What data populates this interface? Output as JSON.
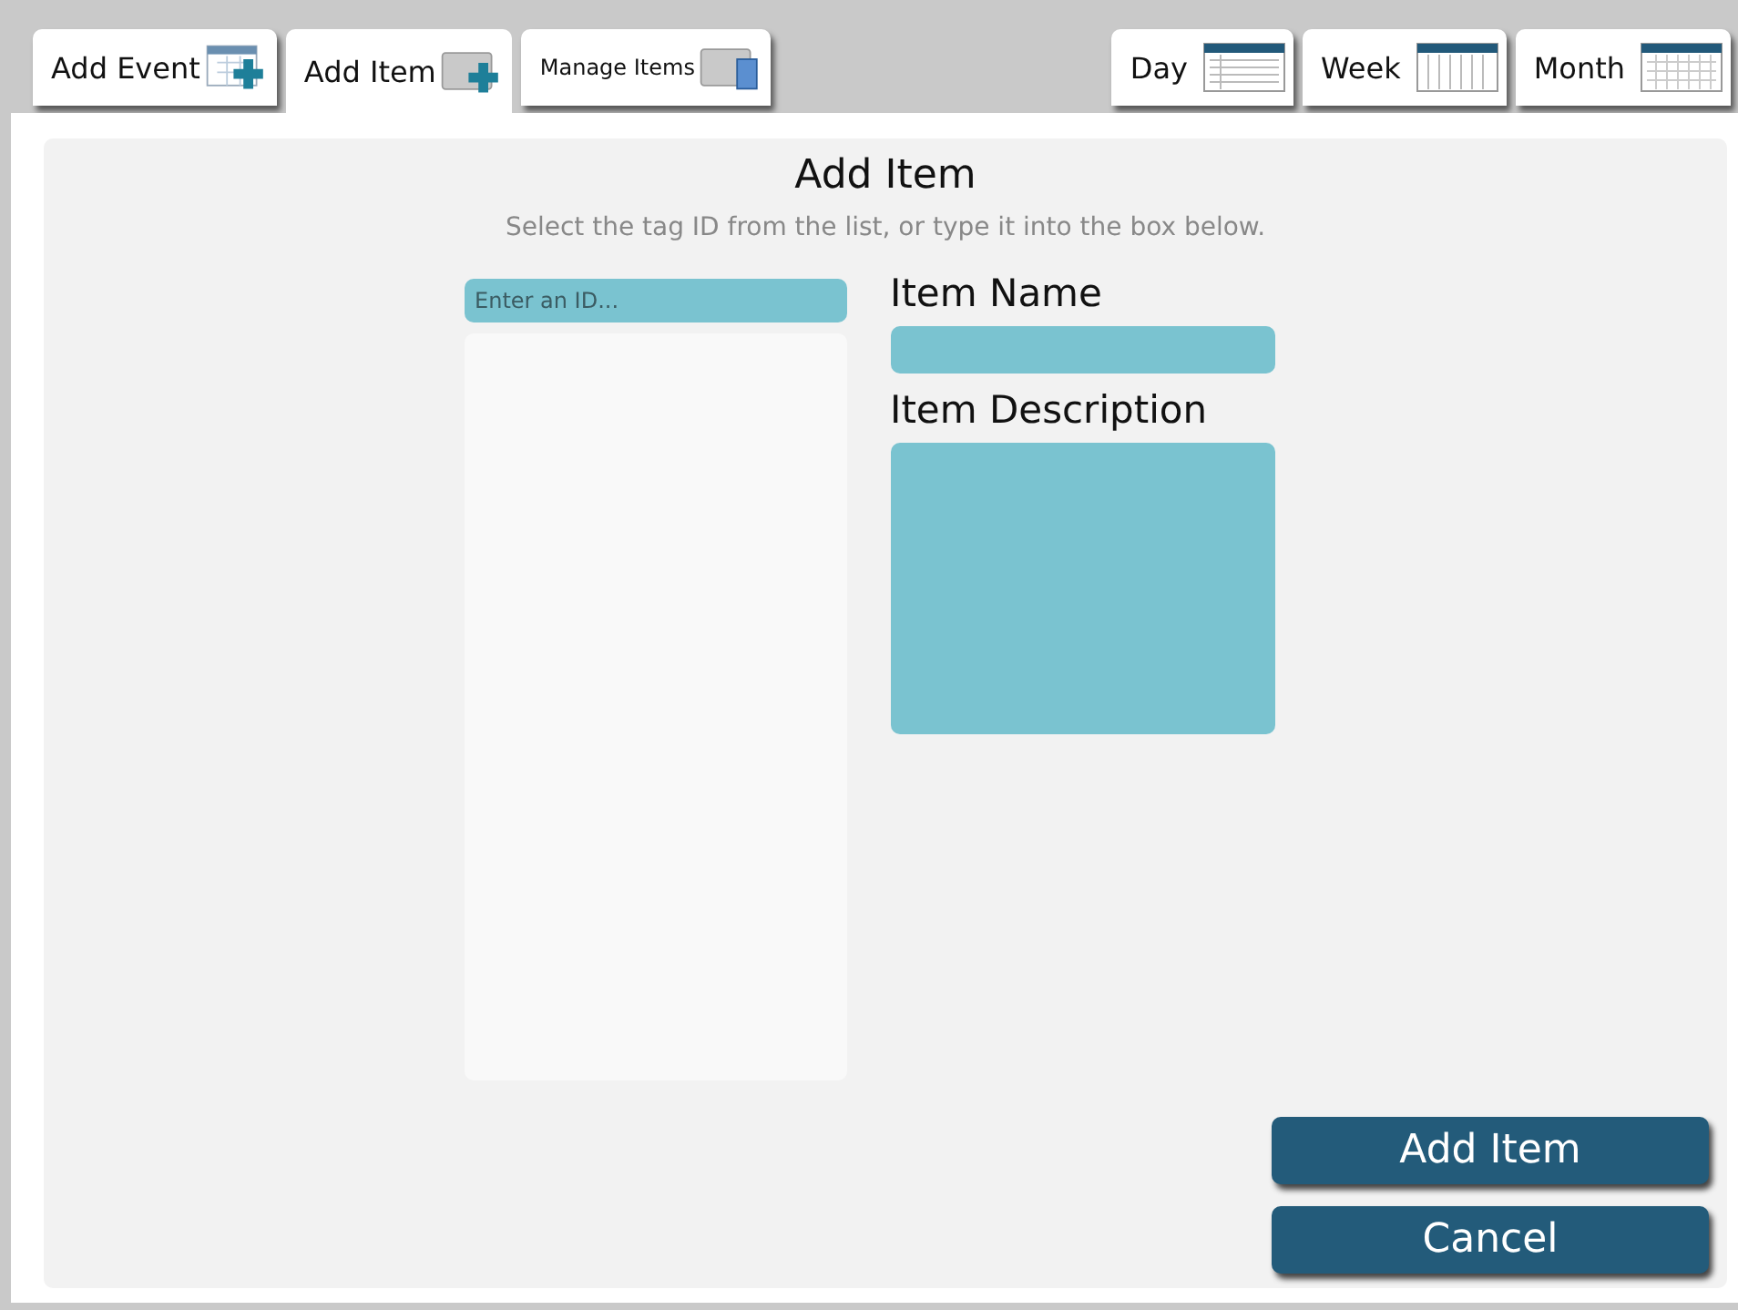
{
  "tabs": [
    {
      "label": "Add Event",
      "kind": "calendar-plus",
      "selected": false
    },
    {
      "label": "Add Item",
      "kind": "wallet-plus",
      "selected": true
    },
    {
      "label": "Manage Items",
      "kind": "wallet-list",
      "selected": false
    }
  ],
  "views": [
    {
      "label": "Day",
      "kind": "day"
    },
    {
      "label": "Week",
      "kind": "week"
    },
    {
      "label": "Month",
      "kind": "month"
    }
  ],
  "title": "Add Item",
  "instructions": "Select the tag ID from the list, or type it into the box below.",
  "id_field": {
    "placeholder": "Enter an ID..."
  },
  "fields": [
    {
      "label": "Item Name",
      "kind": "line"
    },
    {
      "label": "Item Description",
      "kind": "area"
    }
  ],
  "buttons": [
    "Add Item",
    "Cancel"
  ]
}
